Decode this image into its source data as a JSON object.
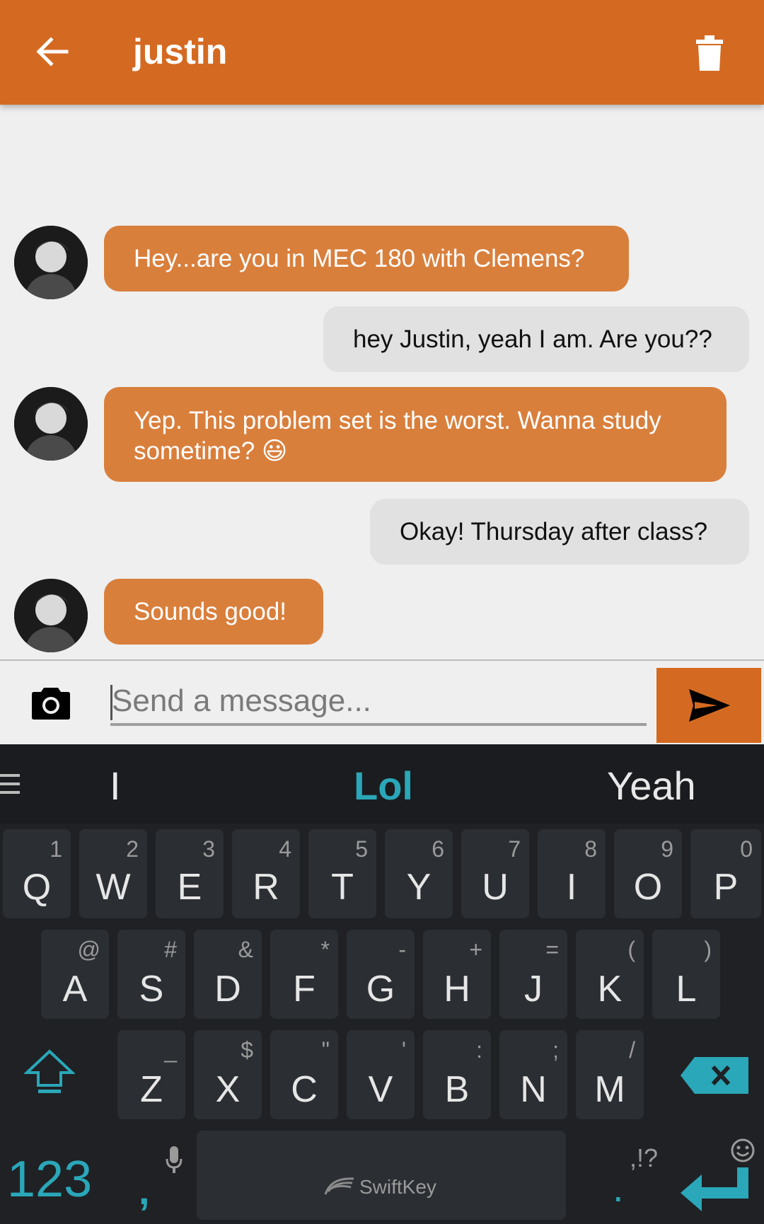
{
  "header": {
    "title": "justin"
  },
  "messages": [
    {
      "side": "in",
      "text": "Hey...are you in MEC 180 with Clemens?"
    },
    {
      "side": "out",
      "text": "hey Justin, yeah I am. Are you??"
    },
    {
      "side": "in",
      "line1": "Yep. This problem set is the worst. Wanna study",
      "line2": "sometime?",
      "emoji": "😃"
    },
    {
      "side": "out",
      "text": "Okay! Thursday after class?"
    },
    {
      "side": "in",
      "text": "Sounds good!"
    }
  ],
  "composer": {
    "placeholder": "Send a message..."
  },
  "keyboard": {
    "suggestions": [
      "I",
      "Lol",
      "Yeah"
    ],
    "row1": [
      [
        "Q",
        "1"
      ],
      [
        "W",
        "2"
      ],
      [
        "E",
        "3"
      ],
      [
        "R",
        "4"
      ],
      [
        "T",
        "5"
      ],
      [
        "Y",
        "6"
      ],
      [
        "U",
        "7"
      ],
      [
        "I",
        "8"
      ],
      [
        "O",
        "9"
      ],
      [
        "P",
        "0"
      ]
    ],
    "row2": [
      [
        "A",
        "@"
      ],
      [
        "S",
        "#"
      ],
      [
        "D",
        "&"
      ],
      [
        "F",
        "*"
      ],
      [
        "G",
        "-"
      ],
      [
        "H",
        "+"
      ],
      [
        "J",
        "="
      ],
      [
        "K",
        "("
      ],
      [
        "L",
        ")"
      ]
    ],
    "row3": [
      [
        "Z",
        "_"
      ],
      [
        "X",
        "$"
      ],
      [
        "C",
        "\""
      ],
      [
        "V",
        "'"
      ],
      [
        "B",
        ":"
      ],
      [
        "N",
        ";"
      ],
      [
        "M",
        "/"
      ]
    ],
    "numbers_key": "123",
    "comma_key": ",",
    "period_key": ".",
    "punct_hint": ",!?",
    "space_brand": "SwiftKey"
  },
  "colors": {
    "accent": "#d46a21",
    "incoming_bubble": "#d97f3c",
    "outgoing_bubble": "#e1e1e1",
    "keyboard_accent": "#2aa7b8"
  }
}
